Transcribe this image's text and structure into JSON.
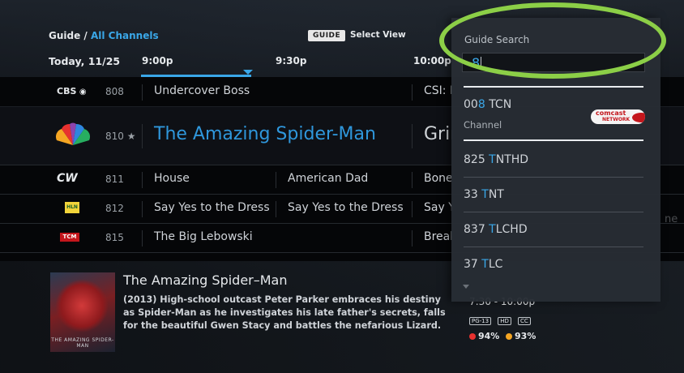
{
  "header": {
    "breadcrumb_root": "Guide / ",
    "breadcrumb_link": "All Channels",
    "guide_pill": "GUIDE",
    "select_view": "Select View"
  },
  "timebar": {
    "date": "Today, 11/25",
    "slots": [
      "9:00p",
      "9:30p",
      "10:00p"
    ]
  },
  "grid": {
    "rows": [
      {
        "logo": "cbs-logo",
        "logo_text": "CBS",
        "channel": "808",
        "fav": "",
        "programs": [
          "Undercover Boss",
          "CSI: N"
        ]
      },
      {
        "logo": "nbc-peacock-logo",
        "logo_text": "",
        "channel": "810",
        "fav": "★",
        "programs": [
          "The Amazing Spider-Man",
          "Grim"
        ]
      },
      {
        "logo": "cw-logo",
        "logo_text": "CW",
        "channel": "811",
        "fav": "",
        "programs": [
          "House",
          "American Dad",
          "Bone"
        ]
      },
      {
        "logo": "hln-logo",
        "logo_text": "HLN",
        "channel": "812",
        "fav": "",
        "programs": [
          "Say Yes to the Dress",
          "Say Yes to the Dress",
          "Say Y"
        ]
      },
      {
        "logo": "tcm-logo",
        "logo_text": "TCM",
        "channel": "815",
        "fav": "",
        "programs": [
          "The Big Lebowski",
          "Break"
        ]
      }
    ]
  },
  "detail": {
    "title": "The Amazing Spider–Man",
    "description": "(2013) High-school outcast Peter Parker embraces his destiny as Spider-Man as he investigates his late father's secrets, falls for the beautiful Gwen Stacy and battles the nefarious Lizard.",
    "time": "7:30 - 10:00p",
    "badges": [
      "PG-13",
      "HD",
      "CC"
    ],
    "critic_score": "94%",
    "audience_score": "93%",
    "poster_text": "THE AMAZING SPIDER-MAN"
  },
  "search": {
    "title": "Guide Search",
    "query": "8",
    "top_result": {
      "prefix": "00",
      "match": "8",
      "rest": " TCN",
      "type": "Channel",
      "network": "comcast NETWORK"
    },
    "results": [
      {
        "prefix": "825 ",
        "match": "T",
        "rest": "NTHD"
      },
      {
        "prefix": "33 ",
        "match": "T",
        "rest": "NT"
      },
      {
        "prefix": "837 ",
        "match": "T",
        "rest": "LCHD"
      },
      {
        "prefix": "37 ",
        "match": "T",
        "rest": "LC"
      }
    ]
  },
  "ghost_text": [
    "ne"
  ],
  "colors": {
    "accent": "#3aa7e8",
    "highlight_ring": "#8ccf47",
    "panel": "#282d34"
  }
}
